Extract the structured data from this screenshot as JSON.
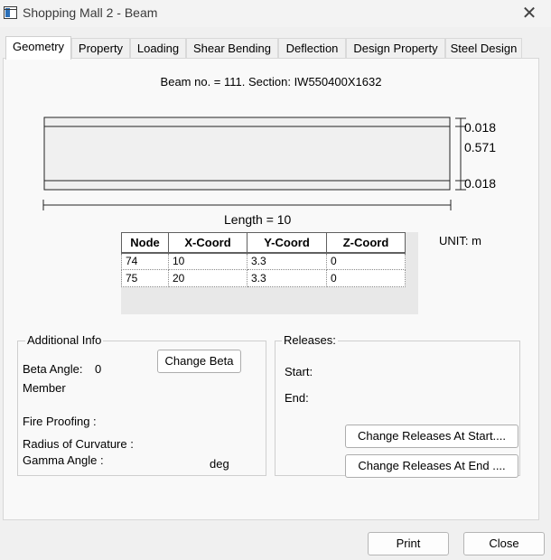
{
  "window": {
    "title": "Shopping Mall 2 - Beam",
    "close": "✕"
  },
  "tabs": [
    "Geometry",
    "Property",
    "Loading",
    "Shear Bending",
    "Deflection",
    "Design Property",
    "Steel Design"
  ],
  "geometry": {
    "beam_title": "Beam no. = 111. Section: IW550400X1632",
    "dims": {
      "top_flange": "0.018",
      "web": "0.571",
      "bottom_flange": "0.018"
    },
    "length_label": "Length = 10",
    "unit_label": "UNIT: m",
    "table": {
      "headers": [
        "Node",
        "X-Coord",
        "Y-Coord",
        "Z-Coord"
      ],
      "rows": [
        [
          "74",
          "10",
          "3.3",
          "0"
        ],
        [
          "75",
          "20",
          "3.3",
          "0"
        ]
      ]
    }
  },
  "additional_info": {
    "legend": "Additional Info",
    "beta_angle_label": "Beta Angle:",
    "beta_angle_value": "0",
    "member_label": "Member",
    "change_beta_button": "Change Beta",
    "fire_proofing_label": "Fire Proofing :",
    "radius_label": "Radius of Curvature :",
    "gamma_label": "Gamma Angle :",
    "gamma_unit": "deg"
  },
  "releases": {
    "legend": "Releases:",
    "start_label": "Start:",
    "end_label": "End:",
    "change_start_button": "Change Releases At Start....",
    "change_end_button": "Change Releases At End ...."
  },
  "footer": {
    "print_button": "Print",
    "close_button": "Close"
  }
}
